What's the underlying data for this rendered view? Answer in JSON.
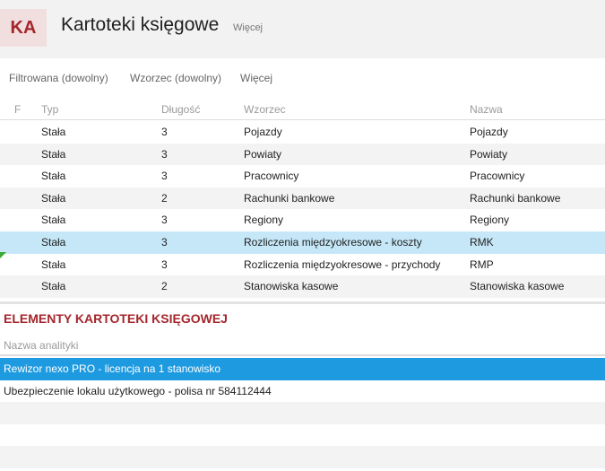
{
  "header": {
    "badge": "KA",
    "title": "Kartoteki księgowe",
    "more_label": "Więcej"
  },
  "filterbar": {
    "filter_label": "Filtrowana (dowolny)",
    "pattern_label": "Wzorzec (dowolny)",
    "more_label": "Więcej"
  },
  "grid": {
    "columns": [
      "F",
      "Typ",
      "Długość",
      "Wzorzec",
      "Nazwa"
    ],
    "rows": [
      {
        "typ": "Stała",
        "dlugosc": "3",
        "wzorzec": "Pojazdy",
        "nazwa": "Pojazdy"
      },
      {
        "typ": "Stała",
        "dlugosc": "3",
        "wzorzec": "Powiaty",
        "nazwa": "Powiaty"
      },
      {
        "typ": "Stała",
        "dlugosc": "3",
        "wzorzec": "Pracownicy",
        "nazwa": "Pracownicy"
      },
      {
        "typ": "Stała",
        "dlugosc": "2",
        "wzorzec": "Rachunki bankowe",
        "nazwa": "Rachunki bankowe"
      },
      {
        "typ": "Stała",
        "dlugosc": "3",
        "wzorzec": "Regiony",
        "nazwa": "Regiony"
      },
      {
        "typ": "Stała",
        "dlugosc": "3",
        "wzorzec": "Rozliczenia międzyokresowe - koszty",
        "nazwa": "RMK"
      },
      {
        "typ": "Stała",
        "dlugosc": "3",
        "wzorzec": "Rozliczenia międzyokresowe - przychody",
        "nazwa": "RMP"
      },
      {
        "typ": "Stała",
        "dlugosc": "2",
        "wzorzec": "Stanowiska kasowe",
        "nazwa": "Stanowiska kasowe"
      }
    ]
  },
  "elements": {
    "title": "ELEMENTY KARTOTEKI KSIĘGOWEJ",
    "column": "Nazwa analityki",
    "rows": [
      "Rewizor nexo PRO - licencja na 1 stanowisko",
      "Ubezpieczenie lokalu użytkowego - polisa nr 584112444",
      "",
      ""
    ]
  },
  "colors": {
    "accent": "#a4262c",
    "selected_row": "#c5e7f7",
    "selected_sub_row": "#1e9be0"
  }
}
